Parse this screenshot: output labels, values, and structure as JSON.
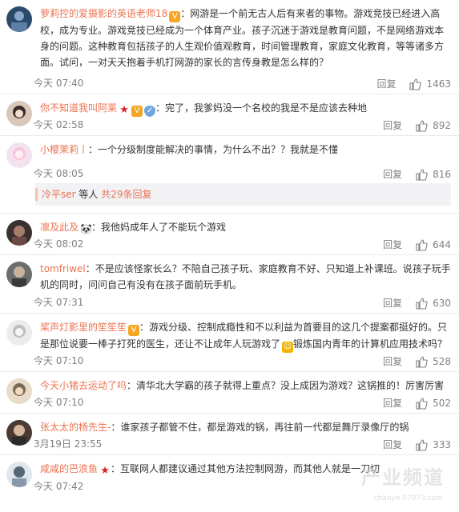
{
  "comments": [
    {
      "username": "萝莉控的爱摄影的英语老师18",
      "text": "：网游是一个前无古人后有来者的事物。游戏竞技已经进入高校，成为专业。游戏竞技已经成为一个体育产业。孩子沉迷于游戏是教育问题，不是网络游戏本身的问题。这种教育包括孩子的人生观价值观教育，时间管理教育，家庭文化教育，等等诸多方面。试问，一对天天抱着手机打网游的家长的言传身教是怎么样的？",
      "time": "今天 07:40",
      "reply": "回复",
      "likes": "1463"
    },
    {
      "username": "你不知道我叫阿莱",
      "text": "：完了，我爹妈没一个名校的我是不是应该去种地",
      "time": "今天 02:58",
      "reply": "回复",
      "likes": "892"
    },
    {
      "username": "小樱茉莉丨",
      "text": "：一个分级制度能解决的事情，为什么不出？？我就是不懂",
      "time": "今天 08:05",
      "reply": "回复",
      "likes": "816"
    },
    {
      "username": "凛及此及",
      "text": "：我他妈成年人了不能玩个游戏",
      "time": "今天 08:02",
      "reply": "回复",
      "likes": "644"
    },
    {
      "username": "tomfriwel",
      "text": "：不是应该怪家长么？不陪自己孩子玩、家庭教育不好、只知道上补课班。说孩子玩手机的同时，问问自己有没有在孩子面前玩手机。",
      "time": "今天 07:31",
      "reply": "回复",
      "likes": "630"
    },
    {
      "username": "桨声灯影里的笙笙笙",
      "text": "：游戏分级、控制成瘾性和不以利益为首要目的这几个提案都挺好的。只是那位说要一棒子打死的医生，还让不让成年人玩游戏了",
      "text2": "锻炼国内青年的计算机应用技术吗？",
      "time": "今天 07:10",
      "reply": "回复",
      "likes": "528"
    },
    {
      "username": "今天小猪去运动了吗",
      "text": "：清华北大学霸的孩子就得上重点？没上成因为游戏？这锅推的！厉害厉害",
      "time": "今天 07:10",
      "reply": "回复",
      "likes": "502"
    },
    {
      "username": "张太太的杨先生-",
      "text": "：谁家孩子都管不住，都是游戏的锅，再往前一代都是舞厅录像厅的锅",
      "time": "3月19日 23:55",
      "reply": "回复",
      "likes": "333"
    },
    {
      "username": "咸咸的巴浪鱼",
      "text": "：互联网人都建议通过其他方法控制网游，而其他人就是一刀切",
      "time": "今天 07:42",
      "reply": "回复",
      "likes": ""
    }
  ],
  "more_replies": {
    "user": "冷平ser",
    "middle": "等人",
    "link": "共29条回复"
  },
  "watermark": {
    "text": "产业频道",
    "url": "chanye.07073.com"
  },
  "colors": {
    "username": "#eb7350",
    "meta": "#808080",
    "divider": "#eaeaea"
  },
  "icons": [
    "thumbs-up-icon",
    "vip-badge-icon",
    "star-badge-icon",
    "shield-badge-icon",
    "panda-icon",
    "avatar"
  ]
}
